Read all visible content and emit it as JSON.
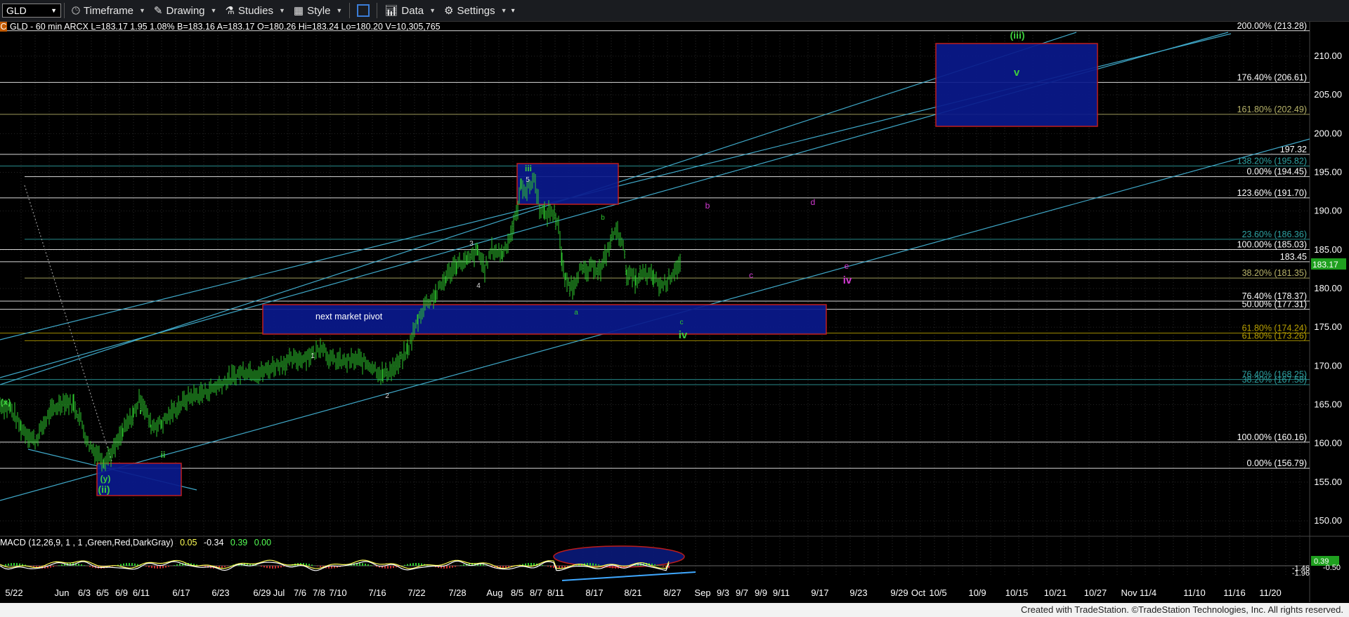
{
  "toolbar": {
    "symbol": "GLD",
    "timeframe": "Timeframe",
    "drawing": "Drawing",
    "studies": "Studies",
    "style": "Style",
    "data": "Data",
    "settings": "Settings"
  },
  "infobar": {
    "badge": "C",
    "text": "GLD - 60 min  ARCX  L=183.17  1.95  1.08%  B=183.16  A=183.17  O=180.26  Hi=183.24  Lo=180.20  V=10,305,765"
  },
  "macd": {
    "label": "MACD (12,26,9, 1 , 1 ,Green,Red,DarkGray)",
    "values": [
      "0.05",
      "-0.34",
      "0.39",
      "0.00"
    ],
    "value_colors": [
      "#ffff55",
      "#ffffff",
      "#55ff55",
      "#55ff55"
    ],
    "right_tag": "0.39",
    "right_values": [
      "-1.46",
      "-1.96",
      "-0.50"
    ]
  },
  "price_axis": [
    "210.00",
    "205.00",
    "200.00",
    "195.00",
    "190.00",
    "185.00",
    "180.00",
    "175.00",
    "170.00",
    "165.00",
    "160.00",
    "155.00",
    "150.00"
  ],
  "current_price": "183.17",
  "levels": [
    {
      "label": "200.00% (213.28)",
      "color": "#ffffff"
    },
    {
      "label": "176.40% (206.61)",
      "color": "#ffffff"
    },
    {
      "label": "161.80% (202.49)",
      "color": "#b8b46a"
    },
    {
      "label": "197.32",
      "color": "#ffffff"
    },
    {
      "label": "138.20% (195.82)",
      "color": "#2ea3a3"
    },
    {
      "label": "0.00% (194.45)",
      "color": "#ffffff"
    },
    {
      "label": "123.60% (191.70)",
      "color": "#ffffff"
    },
    {
      "label": "23.60% (186.36)",
      "color": "#2ea3a3"
    },
    {
      "label": "100.00% (185.03)",
      "color": "#ffffff"
    },
    {
      "label": "183.45",
      "color": "#ffffff"
    },
    {
      "label": "38.20% (181.35)",
      "color": "#b8b46a"
    },
    {
      "label": "76.40% (178.37)",
      "color": "#ffffff"
    },
    {
      "label": "50.00% (177.31)",
      "color": "#ffffff"
    },
    {
      "label": "61.80% (174.24)",
      "color": "#b8a000"
    },
    {
      "label": "61.80% (173.26)",
      "color": "#b8a000"
    },
    {
      "label": "76.40% (168.25)",
      "color": "#2ea3a3"
    },
    {
      "label": "38.20% (167.58)",
      "color": "#2ea3a3"
    },
    {
      "label": "100.00% (160.16)",
      "color": "#ffffff"
    },
    {
      "label": "0.00% (156.79)",
      "color": "#ffffff"
    }
  ],
  "date_axis": [
    "5/22",
    "Jun",
    "6/3",
    "6/5",
    "6/9",
    "6/11",
    "6/17",
    "6/23",
    "6/29",
    "Jul",
    "7/6",
    "7/8",
    "7/10",
    "7/16",
    "7/22",
    "7/28",
    "Aug",
    "8/5",
    "8/7",
    "8/11",
    "8/17",
    "8/21",
    "8/27",
    "Sep",
    "9/3",
    "9/7",
    "9/9",
    "9/11",
    "9/17",
    "9/23",
    "9/29",
    "Oct",
    "10/5",
    "10/9",
    "10/15",
    "10/21",
    "10/27",
    "Nov",
    "11/4",
    "11/10",
    "11/16",
    "11/20"
  ],
  "wave_labels": {
    "green": [
      "(iii)",
      "v",
      "iii",
      "(x)",
      "(y)",
      "(ii)",
      "i",
      "ii",
      "iv"
    ],
    "white": [
      "5",
      "3",
      "4",
      "1",
      "2",
      "a",
      "b",
      "c"
    ],
    "magenta": [
      "b",
      "d",
      "c",
      "e",
      "iv"
    ]
  },
  "pivot_label": "next market pivot",
  "footer": "Created with TradeStation. ©TradeStation Technologies, Inc. All rights reserved."
}
